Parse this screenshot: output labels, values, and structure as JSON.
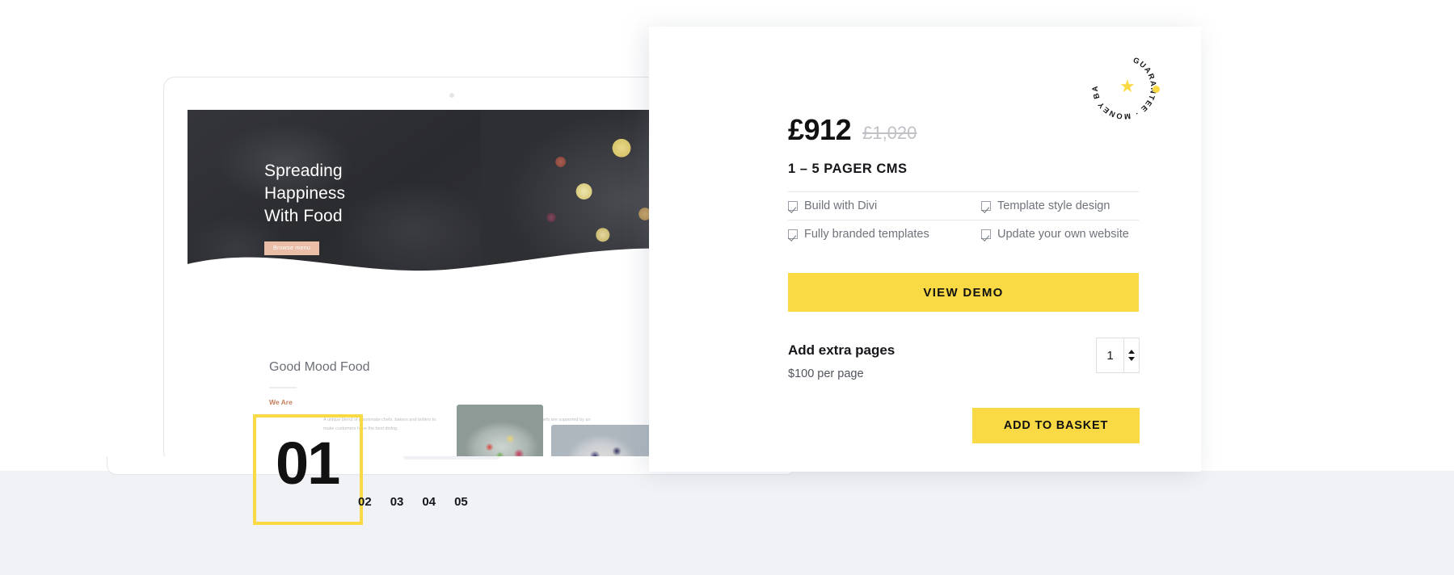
{
  "product": {
    "price_current": "£912",
    "price_original": "£1,020",
    "subtitle": "1 – 5 PAGER CMS",
    "features": [
      "Build with Divi",
      "Template style design",
      "Fully branded templates",
      "Update your own website"
    ],
    "view_demo_label": "VIEW DEMO",
    "extra_pages_title": "Add extra pages",
    "extra_pages_price": "$100 per page",
    "quantity": "1",
    "add_to_basket_label": "ADD TO BASKET",
    "accent_color": "#fada44"
  },
  "badge": {
    "text": "GUARANTEE · MONEY BACK ·",
    "star": "★"
  },
  "mockup": {
    "hero_title": "Spreading\nHappiness\nWith Food",
    "hero_button": "Browse menu",
    "section_title": "Good Mood Food",
    "section_kicker": "We Are",
    "paragraph_left": "A unique blend of passionate chefs, bakers and brillers to make customers have the best dining.",
    "paragraph_right": "The team of three qualified chefs are supported by an outstanding young brigade."
  },
  "pagination": {
    "active": "01",
    "items": [
      "02",
      "03",
      "04",
      "05"
    ]
  }
}
